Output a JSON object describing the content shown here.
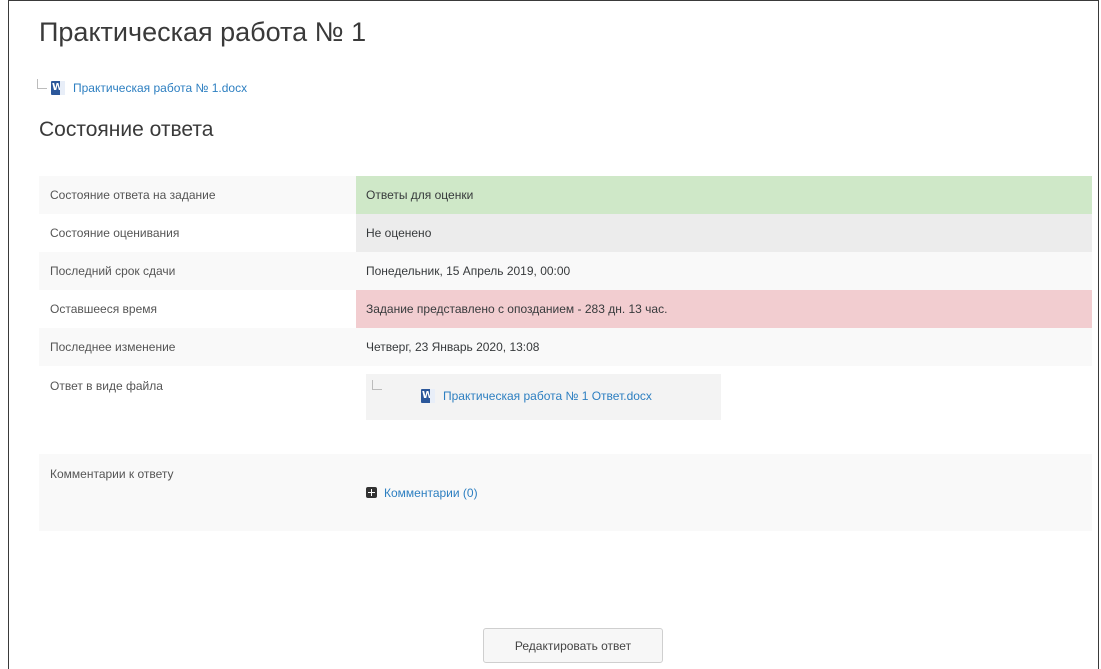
{
  "page": {
    "title": "Практическая работа № 1",
    "attachment": {
      "filename": "Практическая работа № 1.docx",
      "icon": "word-doc-icon"
    }
  },
  "status_section": {
    "title": "Состояние ответа",
    "rows": [
      {
        "label": "Состояние ответа на задание",
        "value": "Ответы для оценки",
        "status": "success"
      },
      {
        "label": "Состояние оценивания",
        "value": "Не оценено",
        "status": "neutral"
      },
      {
        "label": "Последний срок сдачи",
        "value": "Понедельник, 15 Апрель 2019, 00:00"
      },
      {
        "label": "Оставшееся время",
        "value": "Задание представлено с опозданием - 283 дн. 13 час.",
        "status": "danger"
      },
      {
        "label": "Последнее изменение",
        "value": "Четверг, 23 Январь 2020, 13:08"
      },
      {
        "label": "Ответ в виде файла",
        "file": "Практическая работа № 1 Ответ.docx"
      },
      {
        "label": "Комментарии к ответу",
        "comments_link": "Комментарии (0)"
      }
    ]
  },
  "actions": {
    "edit_label": "Редактировать ответ"
  },
  "colors": {
    "success": "#cfe8c8",
    "neutral": "#ececec",
    "danger": "#f2cdd0",
    "link": "#2d7fc1"
  }
}
